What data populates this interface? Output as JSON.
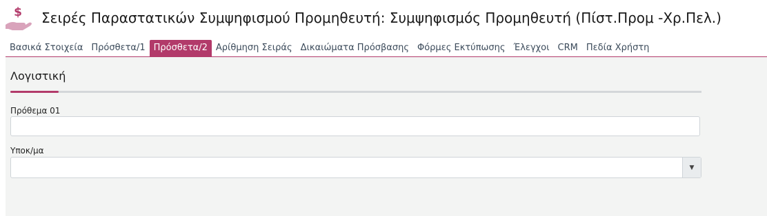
{
  "header": {
    "title": "Σειρές Παραστατικών Συμψηφισμού Προμηθευτή: Συμψηφισμός Προμηθευτή (Πίστ.Προμ -Χρ.Πελ.)",
    "icon": "money-hand-icon",
    "accent_color": "#b23a6a"
  },
  "tabs": [
    {
      "label": "Βασικά Στοιχεία",
      "active": false
    },
    {
      "label": "Πρόσθετα/1",
      "active": false
    },
    {
      "label": "Πρόσθετα/2",
      "active": true
    },
    {
      "label": "Αρίθμηση Σειράς",
      "active": false
    },
    {
      "label": "Δικαιώματα Πρόσβασης",
      "active": false
    },
    {
      "label": "Φόρμες Εκτύπωσης",
      "active": false
    },
    {
      "label": "Έλεγχοι",
      "active": false
    },
    {
      "label": "CRM",
      "active": false
    },
    {
      "label": "Πεδία Χρήστη",
      "active": false
    }
  ],
  "section": {
    "title": "Λογιστική"
  },
  "fields": {
    "prefix": {
      "label": "Πρόθεμα 01",
      "value": ""
    },
    "subaccount": {
      "label": "Υποκ/μα",
      "value": "",
      "arrow_icon": "caret-down-icon"
    }
  }
}
